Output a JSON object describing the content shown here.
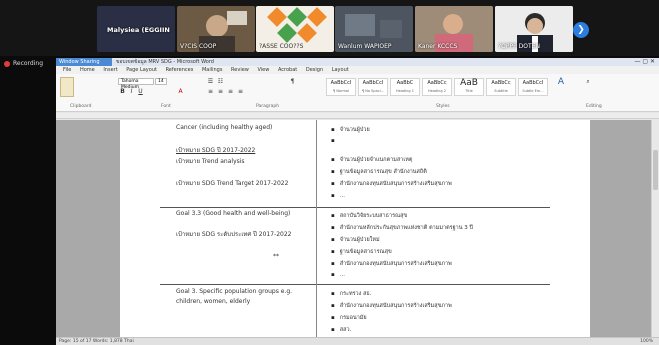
{
  "meeting": {
    "tiles": [
      {
        "name": "Malysiea (EGGIIN"
      },
      {
        "name": "V?CIS COOP"
      },
      {
        "name": "?ASSE COO??S"
      },
      {
        "name": "Wanlum WAPIOEP"
      },
      {
        "name": "Kaner KCCCS"
      },
      {
        "name": "?OPPP DOTEN"
      }
    ],
    "next_icon": "chevron-right-icon",
    "recording_label": "Recording"
  },
  "word": {
    "share_tag": "Window Sharing",
    "title": "ขอบเขตข้อมูล MRV SDG - Microsoft Word",
    "window_controls": "— ▢ ✕",
    "menu_items": [
      "File",
      "Home",
      "Insert",
      "Page Layout",
      "References",
      "Mailings",
      "Review",
      "View",
      "Acrobat",
      "Design",
      "Layout"
    ],
    "font_name": "Tahoma Medium",
    "font_size": "14",
    "group_labels": {
      "clipboard": "Clipboard",
      "font": "Font",
      "paragraph": "Paragraph",
      "styles": "Styles",
      "editing": "Editing"
    },
    "styles": [
      {
        "preview": "AaBbCcI",
        "name": "¶ Normal"
      },
      {
        "preview": "AaBbCcI",
        "name": "¶ No Spaci..."
      },
      {
        "preview": "AaBbC",
        "name": "Heading 1"
      },
      {
        "preview": "AaBbCc",
        "name": "Heading 2"
      },
      {
        "preview": "AaB",
        "name": "Title"
      },
      {
        "preview": "AaBbCc",
        "name": "Subtitle"
      },
      {
        "preview": "AaBbCcI",
        "name": "Subtle Em..."
      }
    ],
    "status": "Page: 15 of 17   Words: 1,878   Thai",
    "zoom": "100%"
  },
  "doc": {
    "rows": [
      {
        "left": [
          "Cancer (including healthy aged)",
          "เป้าหมาย SDG ปี 2017-2022",
          "เป้าหมาย Trend analysis",
          "เป้าหมาย SDG Trend Target 2017-2022"
        ],
        "right": [
          "จำนวนผู้ป่วย",
          "",
          "จำนวนผู้ป่วยจำแนกตามสาเหตุ",
          "ฐานข้อมูลสาธารณสุข สำนักงานสถิติ",
          "สำนักงานกองทุนสนับสนุนการสร้างเสริมสุขภาพ",
          "..."
        ]
      },
      {
        "left": [
          "Goal 3.3 (Good health and well-being)",
          "เป้าหมาย SDG ระดับประเทศ ปี 2017-2022",
          "**"
        ],
        "right": [
          "สถาบันวิจัยระบบสาธารณสุข",
          "สำนักงานหลักประกันสุขภาพแห่งชาติ ตามมาตรฐาน 3 ปี",
          "จำนวนผู้ป่วยใหม่",
          "ฐานข้อมูลสาธารณสุข",
          "สำนักงานกองทุนสนับสนุนการสร้างเสริมสุขภาพ",
          "..."
        ]
      },
      {
        "left": [
          "Goal 3. Specific population groups e.g.",
          "children, women, elderly"
        ],
        "right": [
          "กระทรวง สธ.",
          "สำนักงานกองทุนสนับสนุนการสร้างเสริมสุขภาพ",
          "กรมอนามัย",
          "สสว."
        ]
      }
    ]
  }
}
